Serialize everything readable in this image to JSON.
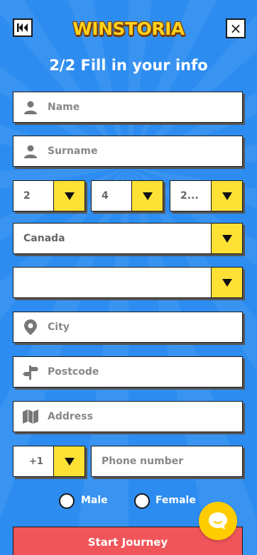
{
  "header": {
    "logo_text": "WINSTORIA",
    "close_label": "×"
  },
  "title": "2/2 Fill in your info",
  "form": {
    "name_placeholder": "Name",
    "surname_placeholder": "Surname",
    "dob_day": "2",
    "dob_month": "4",
    "dob_year": "2...",
    "country": "Canada",
    "region": "",
    "city_placeholder": "City",
    "postcode_placeholder": "Postcode",
    "address_placeholder": "Address",
    "phone_code": "+1",
    "phone_placeholder": "Phone number",
    "gender_male": "Male",
    "gender_female": "Female",
    "submit_label": "Start Journey"
  },
  "colors": {
    "background": "#2d8cf0",
    "accent_yellow": "#ffe135",
    "submit_red": "#f0555a"
  }
}
